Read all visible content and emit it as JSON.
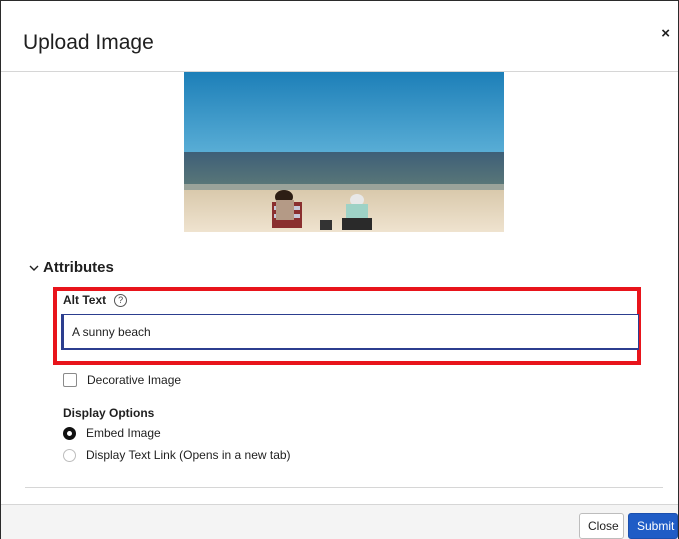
{
  "dialog": {
    "title": "Upload Image",
    "close_glyph": "×"
  },
  "preview": {
    "icon": "beach-photo"
  },
  "attributes": {
    "heading": "Attributes",
    "toggle_icon": "chevron-down-icon",
    "alt_text": {
      "label": "Alt Text",
      "help_glyph": "?",
      "value": "A sunny beach"
    },
    "decorative": {
      "label": "Decorative Image",
      "checked": false
    },
    "display_options": {
      "title": "Display Options",
      "options": [
        {
          "label": "Embed Image",
          "selected": true
        },
        {
          "label": "Display Text Link (Opens in a new tab)",
          "selected": false
        }
      ]
    }
  },
  "footer": {
    "close_label": "Close",
    "submit_label": "Submit"
  },
  "colors": {
    "submit": "#1f5cc6",
    "highlight": "#e8141b",
    "input_border": "#2c3e8f"
  }
}
